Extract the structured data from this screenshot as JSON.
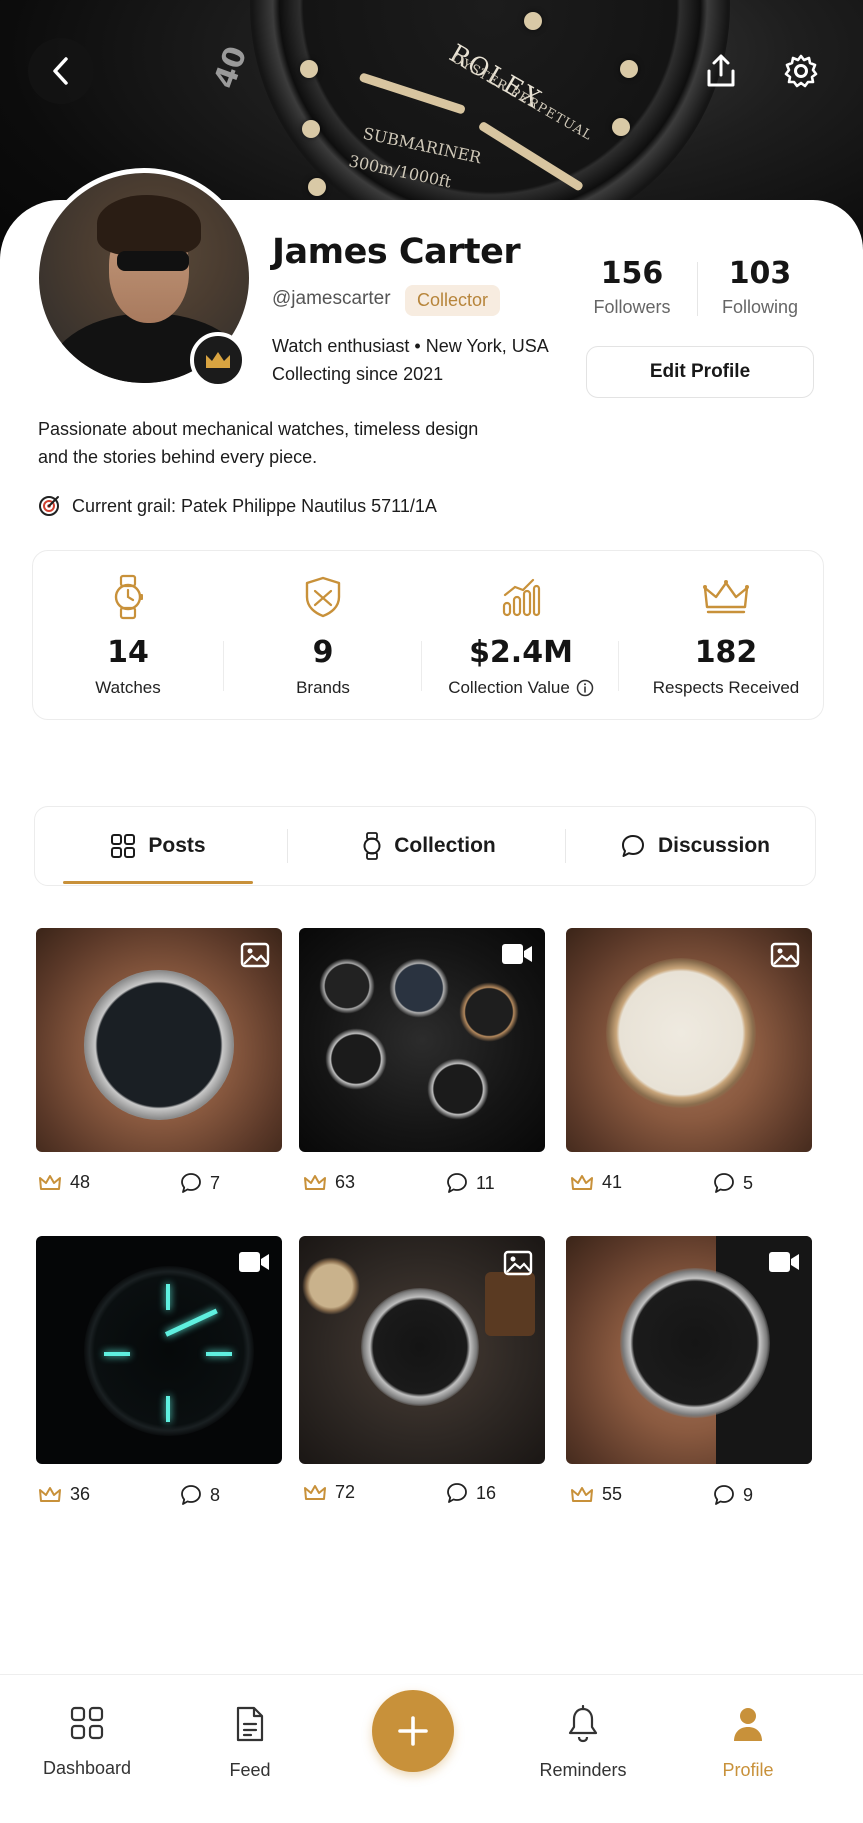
{
  "colors": {
    "accent": "#c8913a",
    "text": "#141414",
    "muted": "#666666",
    "tag_bg": "#f7ece0"
  },
  "cover": {
    "brand_text": "ROLEX",
    "sub_text": "OYSTER PERPETUAL",
    "dial_line_1": "SUBMARINER",
    "dial_line_2": "300m/1000ft",
    "bezel_number": "40"
  },
  "header": {
    "back_icon": "chevron-left-icon",
    "share_icon": "share-icon",
    "settings_icon": "gear-icon"
  },
  "profile": {
    "name": "James Carter",
    "handle": "@jamescarter",
    "tag": "Collector",
    "bio_line_1": "Watch enthusiast • New York, USA",
    "bio_line_2": "Collecting since 2021",
    "about": "Passionate about mechanical watches, timeless design and the stories behind every piece.",
    "grail": "Current grail: Patek Philippe Nautilus 5711/1A",
    "followers": {
      "count": "156",
      "label": "Followers"
    },
    "following": {
      "count": "103",
      "label": "Following"
    },
    "edit_button": "Edit Profile"
  },
  "stats": [
    {
      "icon": "watch-icon",
      "value": "14",
      "label": "Watches"
    },
    {
      "icon": "shield-icon",
      "value": "9",
      "label": "Brands"
    },
    {
      "icon": "growth-chart-icon",
      "value": "$2.4M",
      "label": "Collection Value"
    },
    {
      "icon": "crown-icon",
      "value": "182",
      "label": "Respects Received"
    }
  ],
  "tabs": [
    {
      "label": "Posts",
      "icon": "grid-icon",
      "active": true
    },
    {
      "label": "Collection",
      "icon": "watch-icon",
      "active": false
    },
    {
      "label": "Discussion",
      "icon": "speech-bubble-icon",
      "active": false
    }
  ],
  "posts": [
    {
      "type": "image",
      "respects": "48",
      "comments": "7"
    },
    {
      "type": "video",
      "respects": "63",
      "comments": "11"
    },
    {
      "type": "image",
      "respects": "41",
      "comments": "5"
    },
    {
      "type": "video",
      "respects": "36",
      "comments": "8"
    },
    {
      "type": "image",
      "respects": "72",
      "comments": "16"
    },
    {
      "type": "video",
      "respects": "55",
      "comments": "9"
    }
  ],
  "nav": [
    {
      "label": "Dashboard",
      "icon": "dashboard-icon",
      "active": false
    },
    {
      "label": "Feed",
      "icon": "document-icon",
      "active": false
    },
    {
      "label": "Reminders",
      "icon": "bell-icon",
      "active": false
    },
    {
      "label": "Profile",
      "icon": "user-icon",
      "active": true
    }
  ],
  "fab_icon": "plus-icon"
}
